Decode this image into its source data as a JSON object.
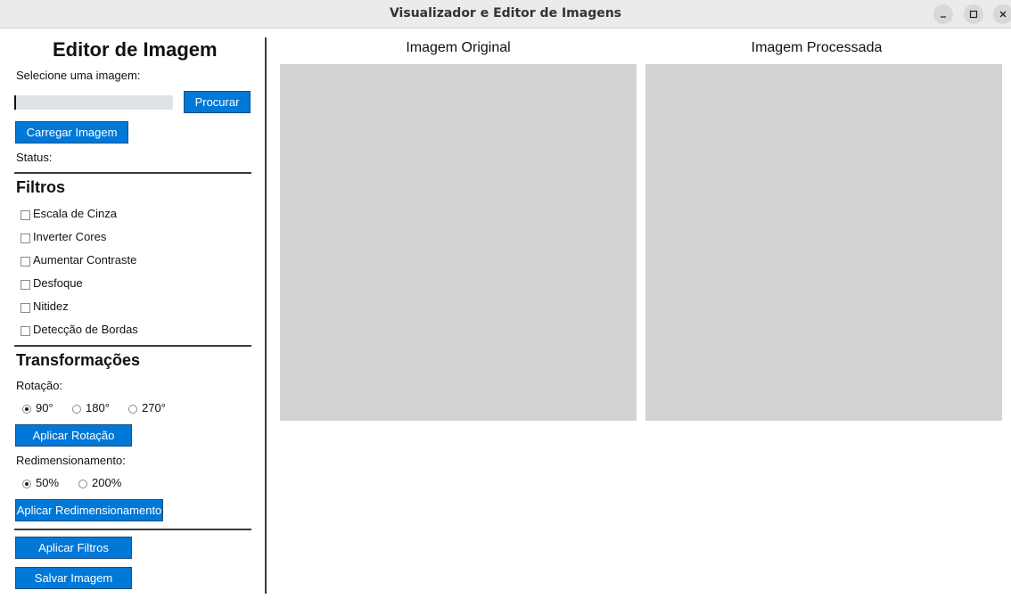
{
  "window": {
    "title": "Visualizador e Editor de Imagens",
    "minimize_icon": "minimize-icon",
    "maximize_icon": "maximize-icon",
    "close_icon": "close-icon"
  },
  "sidebar": {
    "heading": "Editor de Imagem",
    "select_label": "Selecione uma imagem:",
    "path_value": "",
    "browse_label": "Procurar",
    "load_label": "Carregar Imagem",
    "status_label": "Status:",
    "filters_heading": "Filtros",
    "filters": [
      {
        "label": "Escala de Cinza",
        "checked": false
      },
      {
        "label": "Inverter Cores",
        "checked": false
      },
      {
        "label": "Aumentar Contraste",
        "checked": false
      },
      {
        "label": "Desfoque",
        "checked": false
      },
      {
        "label": "Nitidez",
        "checked": false
      },
      {
        "label": "Detecção de Bordas",
        "checked": false
      }
    ],
    "transforms_heading": "Transformações",
    "rotation_label": "Rotação:",
    "rotation_options": [
      "90°",
      "180°",
      "270°"
    ],
    "rotation_selected": "90°",
    "apply_rotation_label": "Aplicar Rotação",
    "resize_label": "Redimensionamento:",
    "resize_options": [
      "50%",
      "200%"
    ],
    "resize_selected": "50%",
    "apply_resize_label": "Aplicar Redimensionamento",
    "apply_filters_label": "Aplicar Filtros",
    "save_label": "Salvar Imagem"
  },
  "main": {
    "original_title": "Imagem Original",
    "processed_title": "Imagem Processada"
  },
  "colors": {
    "accent": "#0078d7",
    "canvas_bg": "#d3d3d3",
    "error_text": "#d62020"
  }
}
